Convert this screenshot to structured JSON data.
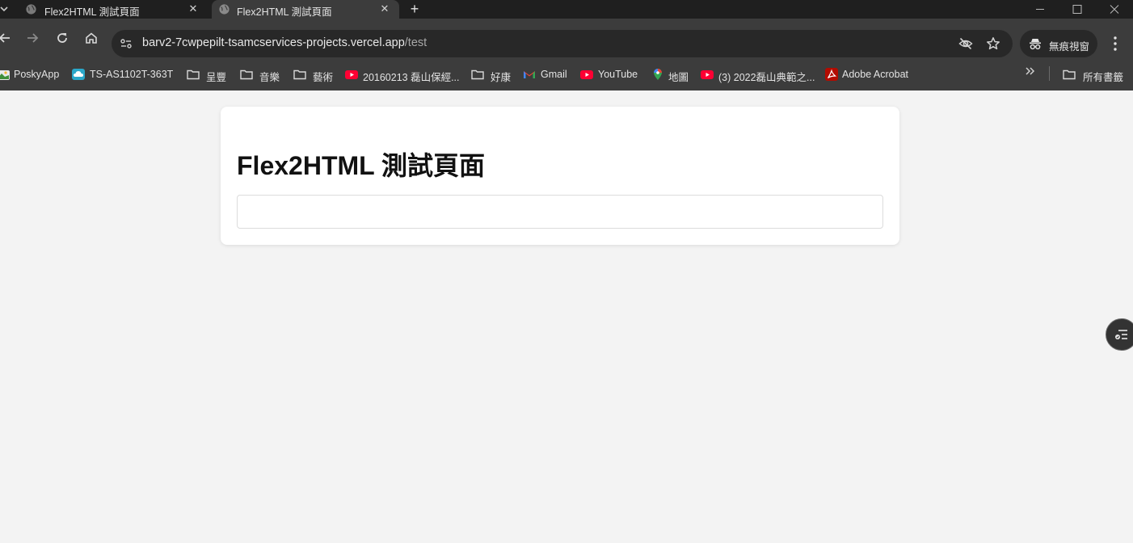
{
  "browser": {
    "tabs": [
      {
        "title": "Flex2HTML 測試頁面",
        "active": false
      },
      {
        "title": "Flex2HTML 測試頁面",
        "active": true
      }
    ],
    "new_tab_label": "+",
    "url_host": "barv2-7cwpepilt-tsamcservices-projects.vercel.app",
    "url_path": "/test",
    "incognito_label": "無痕視窗",
    "bookmarks": [
      {
        "label": "PoskyApp",
        "icon": "poskyapp-icon"
      },
      {
        "label": "TS-AS1102T-363T",
        "icon": "nas-icon"
      },
      {
        "label": "呈豐",
        "icon": "folder-icon"
      },
      {
        "label": "音樂",
        "icon": "folder-icon"
      },
      {
        "label": "藝術",
        "icon": "folder-icon"
      },
      {
        "label": "20160213 磊山保經...",
        "icon": "youtube-icon"
      },
      {
        "label": "好康",
        "icon": "folder-icon"
      },
      {
        "label": "Gmail",
        "icon": "gmail-icon"
      },
      {
        "label": "YouTube",
        "icon": "youtube-icon"
      },
      {
        "label": "地圖",
        "icon": "maps-icon"
      },
      {
        "label": "(3) 2022磊山典範之...",
        "icon": "youtube-icon"
      },
      {
        "label": "Adobe Acrobat",
        "icon": "acrobat-icon"
      }
    ],
    "all_bookmarks_label": "所有書籤",
    "colors": {
      "tabstrip": "#1f1f1f",
      "toolbar": "#3c3c3c",
      "omnibox": "#282828",
      "youtube_red": "#ff0033",
      "acrobat_red": "#b30b00"
    }
  },
  "page": {
    "title": "Flex2HTML 測試頁面",
    "input_value": "",
    "background": "#f3f3f3"
  }
}
